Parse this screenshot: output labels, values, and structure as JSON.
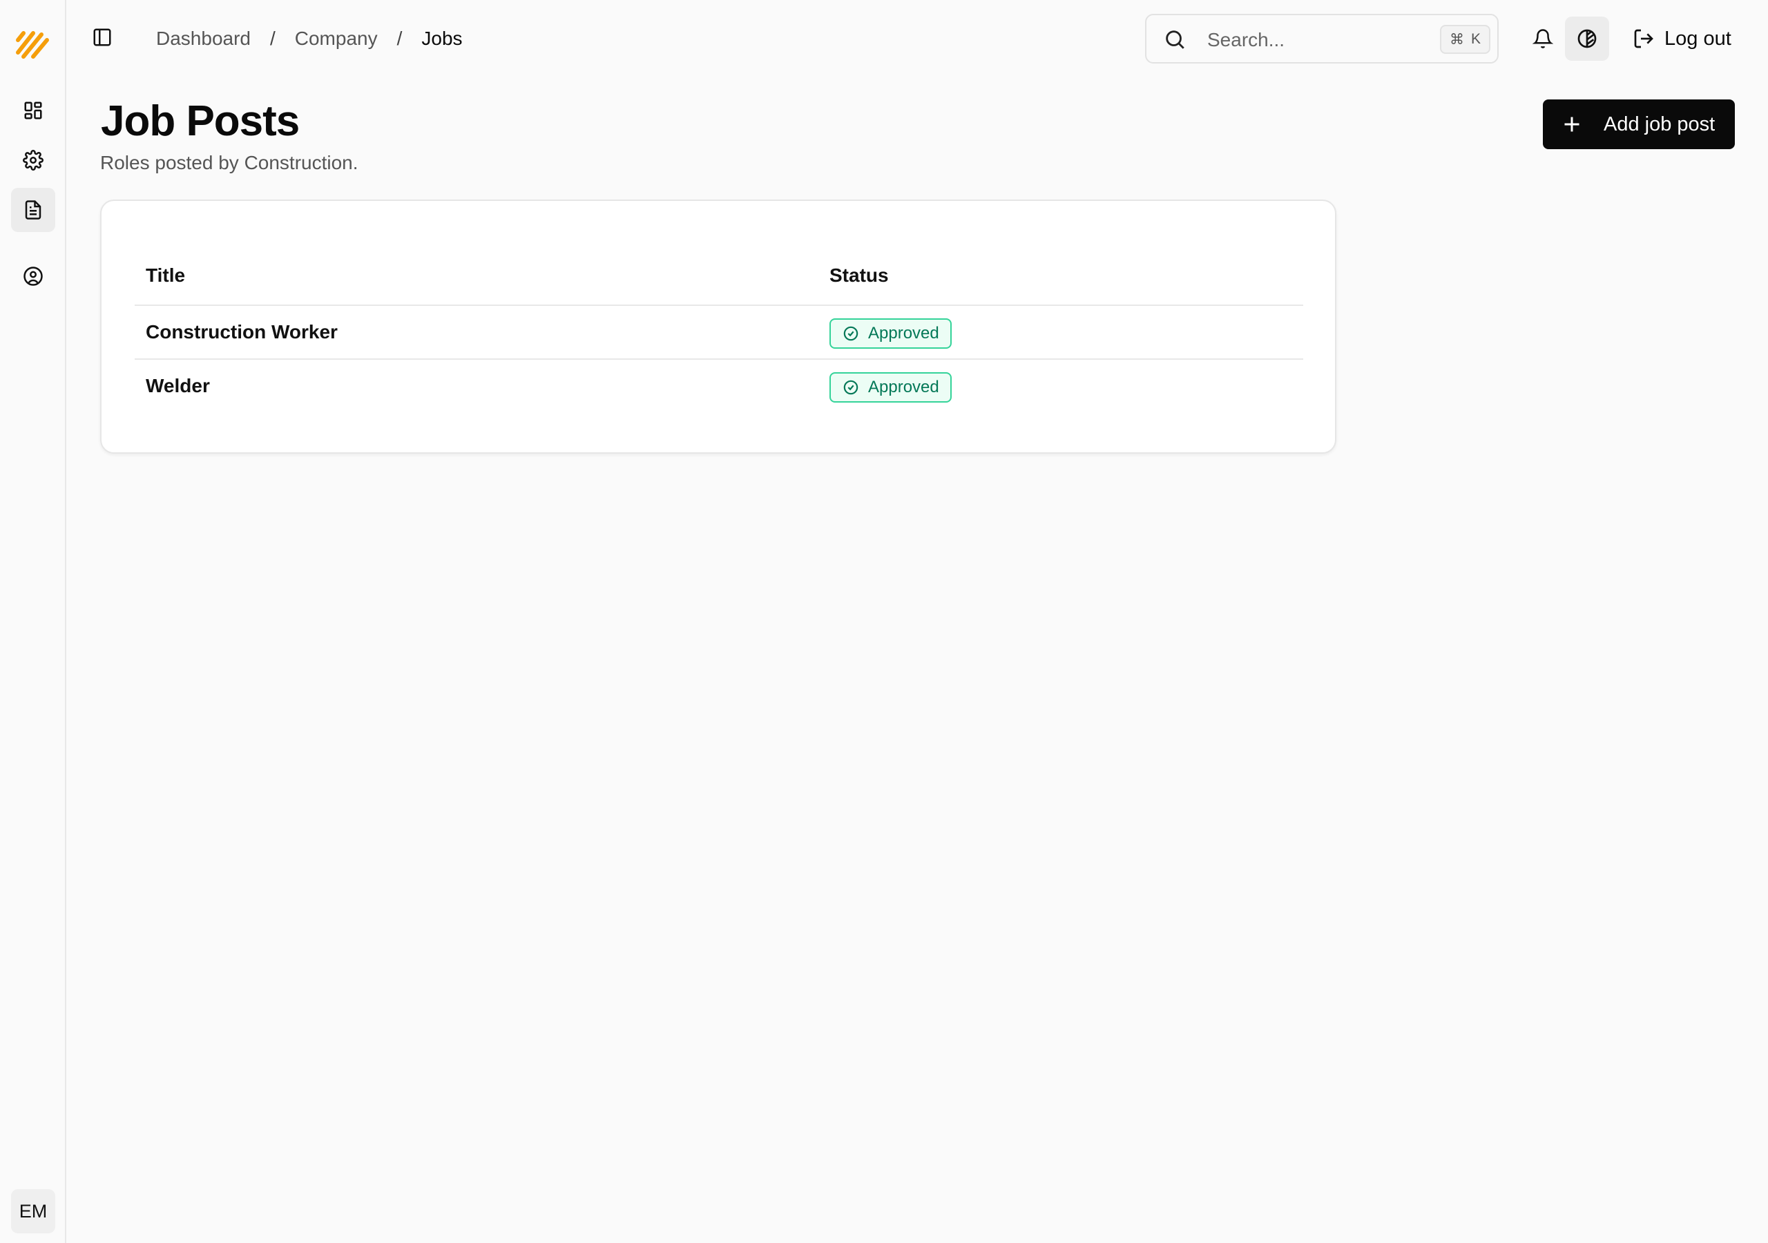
{
  "sidebar": {
    "items": [
      {
        "name": "dashboard"
      },
      {
        "name": "settings"
      },
      {
        "name": "jobs",
        "active": true
      },
      {
        "name": "profile"
      }
    ],
    "avatar_initials": "EM"
  },
  "topbar": {
    "breadcrumb": [
      "Dashboard",
      "Company",
      "Jobs"
    ],
    "breadcrumb_separator": "/",
    "search_placeholder": "Search...",
    "search_shortcut_symbol": "⌘",
    "search_shortcut_key": "K",
    "logout_label": "Log out"
  },
  "page": {
    "title": "Job Posts",
    "subtitle": "Roles posted by Construction.",
    "add_button_label": "Add job post"
  },
  "table": {
    "columns": [
      "Title",
      "Status"
    ],
    "rows": [
      {
        "title": "Construction Worker",
        "status": "Approved"
      },
      {
        "title": "Welder",
        "status": "Approved"
      }
    ]
  },
  "colors": {
    "accent": "#f59e0b",
    "primary_button": "#0a0a0a",
    "status_approved_border": "#34d399",
    "status_approved_text": "#047857"
  }
}
